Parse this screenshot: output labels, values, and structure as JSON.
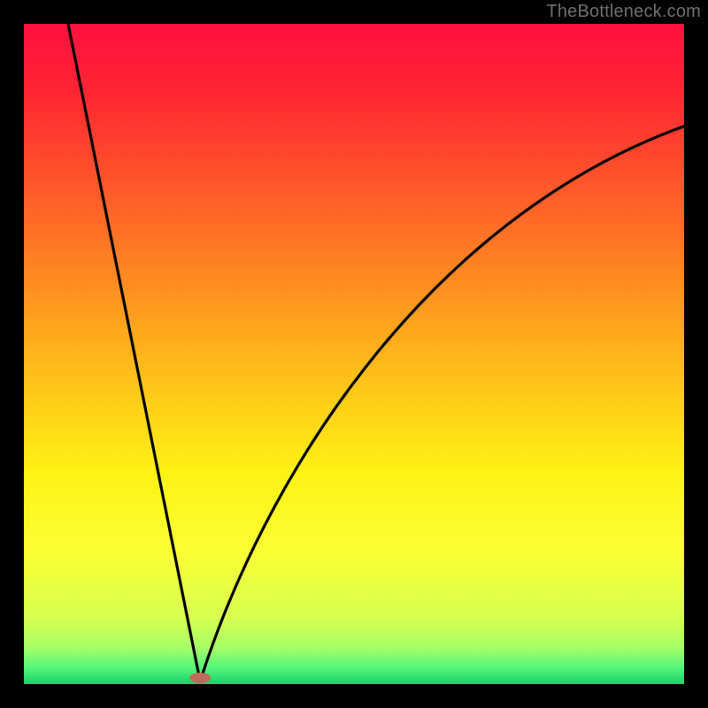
{
  "watermark": {
    "text": "TheBottleneck.com"
  },
  "gradient": {
    "stops": [
      {
        "offset": 0.0,
        "color": "#ff103f"
      },
      {
        "offset": 0.1,
        "color": "#ff2433"
      },
      {
        "offset": 0.25,
        "color": "#ff592a"
      },
      {
        "offset": 0.4,
        "color": "#ff8f20"
      },
      {
        "offset": 0.55,
        "color": "#ffc619"
      },
      {
        "offset": 0.68,
        "color": "#fff215"
      },
      {
        "offset": 0.8,
        "color": "#fbff33"
      },
      {
        "offset": 0.9,
        "color": "#d7ff50"
      },
      {
        "offset": 0.945,
        "color": "#a6ff68"
      },
      {
        "offset": 0.975,
        "color": "#55f57a"
      },
      {
        "offset": 1.0,
        "color": "#18d36a"
      }
    ]
  },
  "marker": {
    "x_frac": 0.267,
    "rx": 12,
    "ry": 6,
    "fill": "#c06a5c"
  },
  "curve": {
    "left_start_y_frac": 0.0,
    "left_start_x_frac": 0.067,
    "dip_x_frac": 0.267,
    "right_end_x_frac": 1.0,
    "right_end_y_frac": 0.155,
    "ctrl1_x_frac": 0.36,
    "ctrl1_y_frac": 0.7,
    "ctrl2_x_frac": 0.6,
    "ctrl2_y_frac": 0.3,
    "stroke": "#000000",
    "stroke_width": 3.2
  },
  "chart_data": {
    "type": "line",
    "title": "",
    "xlabel": "",
    "ylabel": "",
    "xlim": [
      0,
      1
    ],
    "ylim": [
      0,
      1
    ],
    "series": [
      {
        "name": "bottleneck-curve",
        "x": [
          0.067,
          0.1,
          0.14,
          0.18,
          0.22,
          0.25,
          0.267,
          0.29,
          0.33,
          0.38,
          0.45,
          0.55,
          0.65,
          0.75,
          0.85,
          0.93,
          1.0
        ],
        "y": [
          1.0,
          0.84,
          0.67,
          0.48,
          0.27,
          0.1,
          0.0,
          0.09,
          0.25,
          0.4,
          0.54,
          0.66,
          0.74,
          0.79,
          0.82,
          0.84,
          0.845
        ]
      }
    ],
    "annotations": [
      {
        "type": "marker",
        "x": 0.267,
        "y": 0.0,
        "label": "optimal-point"
      }
    ],
    "notes": "y is a qualitative bottleneck/mismatch metric inferred from the colored background: 0 (green, bottom) = no bottleneck, 1 (red, top) = severe bottleneck. x is an unlabeled normalized axis."
  }
}
